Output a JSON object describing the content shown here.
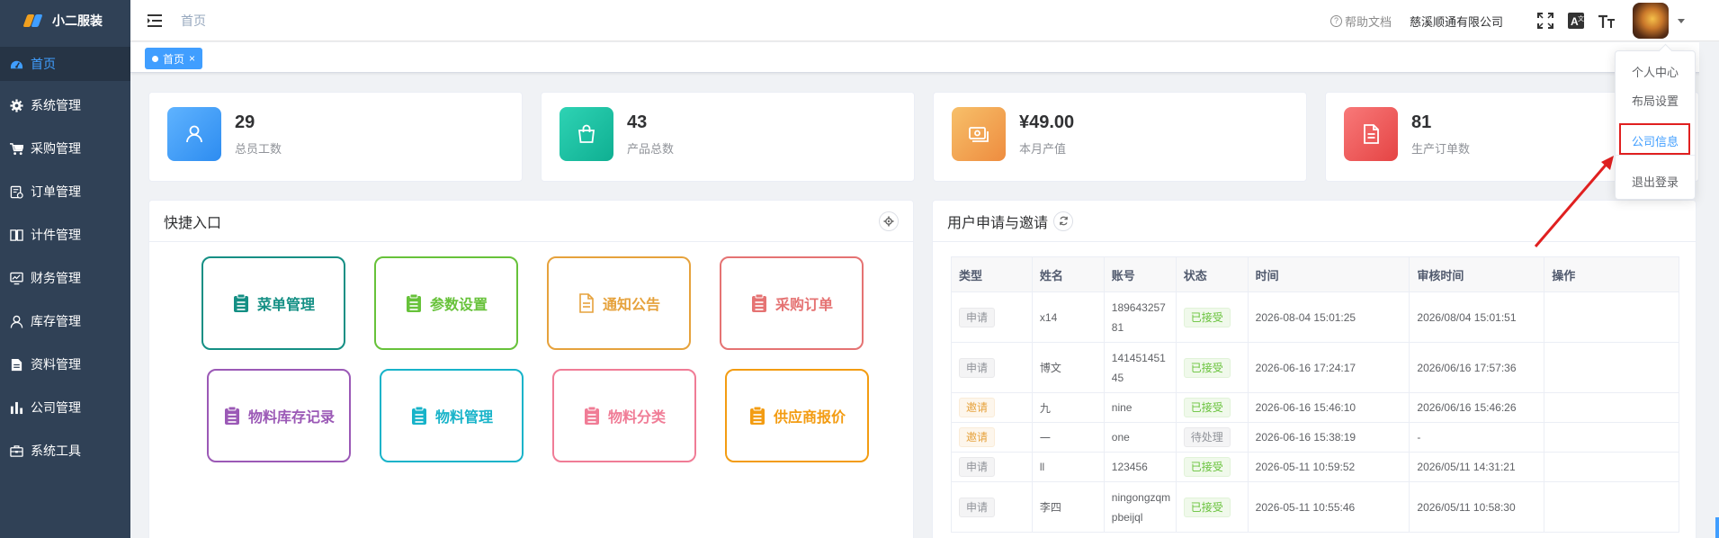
{
  "app": {
    "name": "小二服装"
  },
  "sidebar": {
    "items": [
      {
        "label": "首页",
        "icon": "dashboard-icon",
        "active": true
      },
      {
        "label": "系统管理",
        "icon": "gear-icon"
      },
      {
        "label": "采购管理",
        "icon": "cart-icon"
      },
      {
        "label": "订单管理",
        "icon": "order-icon"
      },
      {
        "label": "计件管理",
        "icon": "book-icon"
      },
      {
        "label": "财务管理",
        "icon": "finance-icon"
      },
      {
        "label": "库存管理",
        "icon": "user-icon"
      },
      {
        "label": "资料管理",
        "icon": "document-icon"
      },
      {
        "label": "公司管理",
        "icon": "bar-chart-icon"
      },
      {
        "label": "系统工具",
        "icon": "toolbox-icon"
      }
    ]
  },
  "navbar": {
    "breadcrumb": "首页",
    "help_label": "帮助文档",
    "company": "慈溪顺通有限公司"
  },
  "tags": [
    {
      "label": "首页",
      "close": "×"
    }
  ],
  "stats": [
    {
      "value": "29",
      "label": "总员工数",
      "color": "#409eff",
      "icon": "user-icon"
    },
    {
      "value": "43",
      "label": "产品总数",
      "color": "#13c2a3",
      "icon": "bag-icon"
    },
    {
      "value": "¥49.00",
      "label": "本月产值",
      "color": "#f0a050",
      "icon": "money-icon"
    },
    {
      "value": "81",
      "label": "生产订单数",
      "color": "#f05a5a",
      "icon": "document-icon"
    }
  ],
  "quick": {
    "title": "快捷入口",
    "items": [
      {
        "label": "菜单管理",
        "color": "#148f84"
      },
      {
        "label": "参数设置",
        "color": "#67c23a"
      },
      {
        "label": "通知公告",
        "color": "#e6a23c"
      },
      {
        "label": "采购订单",
        "color": "#e57373"
      },
      {
        "label": "物料库存记录",
        "color": "#9b59b6"
      },
      {
        "label": "物料管理",
        "color": "#17b3c9"
      },
      {
        "label": "物料分类",
        "color": "#f07c96"
      },
      {
        "label": "供应商报价",
        "color": "#f39c12"
      }
    ]
  },
  "requests": {
    "title": "用户申请与邀请",
    "columns": [
      "类型",
      "姓名",
      "账号",
      "状态",
      "时间",
      "审核时间",
      "操作"
    ],
    "rows": [
      {
        "type": "申请",
        "name": "x14",
        "account": "18964325781",
        "status": "已接受",
        "time": "2026-08-04 15:01:25",
        "review": "2026/08/04 15:01:51"
      },
      {
        "type": "申请",
        "name": "博文",
        "account": "14145145145",
        "status": "已接受",
        "time": "2026-06-16 17:24:17",
        "review": "2026/06/16 17:57:36"
      },
      {
        "type": "邀请",
        "name": "九",
        "account": "nine",
        "status": "已接受",
        "time": "2026-06-16 15:46:10",
        "review": "2026/06/16 15:46:26"
      },
      {
        "type": "邀请",
        "name": "一",
        "account": "one",
        "status": "待处理",
        "time": "2026-06-16 15:38:19",
        "review": "-"
      },
      {
        "type": "申请",
        "name": "ll",
        "account": "123456",
        "status": "已接受",
        "time": "2026-05-11 10:59:52",
        "review": "2026/05/11 14:31:21"
      },
      {
        "type": "申请",
        "name": "李四",
        "account": "ningongzqmpbeijql",
        "status": "已接受",
        "time": "2026-05-11 10:55:46",
        "review": "2026/05/11 10:58:30"
      }
    ]
  },
  "dropdown": {
    "items": [
      "个人中心",
      "布局设置",
      "公司信息",
      "退出登录"
    ],
    "highlighted": "公司信息"
  }
}
